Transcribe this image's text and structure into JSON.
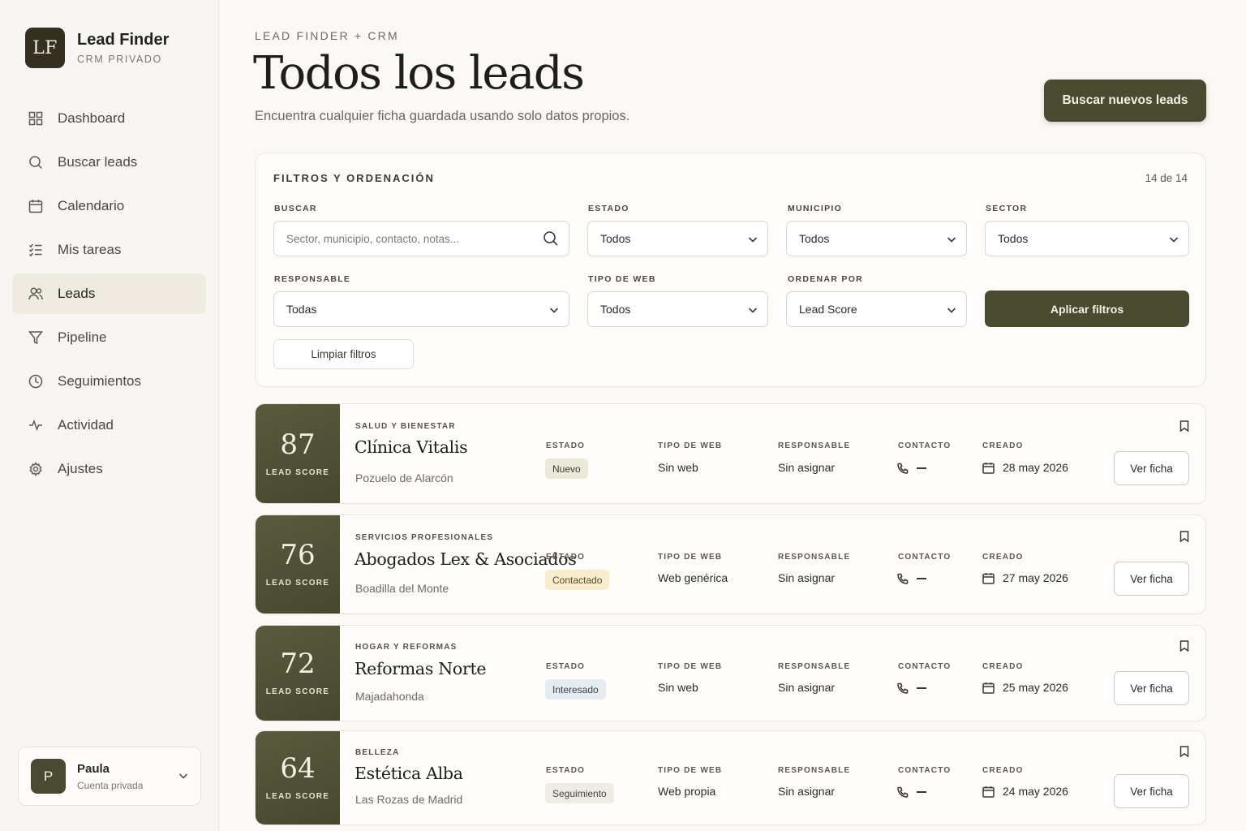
{
  "brand": {
    "logo": "LF",
    "title": "Lead Finder",
    "subtitle": "CRM PRIVADO"
  },
  "nav": [
    {
      "label": "Dashboard",
      "icon": "dashboard-icon"
    },
    {
      "label": "Buscar leads",
      "icon": "search-icon"
    },
    {
      "label": "Calendario",
      "icon": "calendar-icon"
    },
    {
      "label": "Mis tareas",
      "icon": "tasks-icon"
    },
    {
      "label": "Leads",
      "icon": "users-icon",
      "active": true
    },
    {
      "label": "Pipeline",
      "icon": "funnel-icon"
    },
    {
      "label": "Seguimientos",
      "icon": "clock-icon"
    },
    {
      "label": "Actividad",
      "icon": "activity-icon"
    },
    {
      "label": "Ajustes",
      "icon": "gear-icon"
    }
  ],
  "user": {
    "initial": "P",
    "name": "Paula",
    "role": "Cuenta privada"
  },
  "header": {
    "eyebrow": "LEAD FINDER + CRM",
    "title": "Todos los leads",
    "subtitle": "Encuentra cualquier ficha guardada usando solo datos propios.",
    "cta": "Buscar nuevos leads"
  },
  "filters": {
    "title": "FILTROS Y ORDENACIÓN",
    "count": "14 de 14",
    "buscar_label": "BUSCAR",
    "buscar_placeholder": "Sector, municipio, contacto, notas...",
    "estado_label": "ESTADO",
    "estado_value": "Todos",
    "municipio_label": "MUNICIPIO",
    "municipio_value": "Todos",
    "sector_label": "SECTOR",
    "sector_value": "Todos",
    "responsable_label": "RESPONSABLE",
    "responsable_value": "Todas",
    "tipoweb_label": "TIPO DE WEB",
    "tipoweb_value": "Todos",
    "ordenar_label": "ORDENAR POR",
    "ordenar_value": "Lead Score",
    "apply": "Aplicar filtros",
    "clear": "Limpiar filtros"
  },
  "columns": {
    "score": "LEAD SCORE",
    "estado": "ESTADO",
    "tipoweb": "TIPO DE WEB",
    "responsable": "RESPONSABLE",
    "contacto": "CONTACTO",
    "creado": "CREADO",
    "action": "Ver ficha"
  },
  "leads": [
    {
      "score": "87",
      "sector": "SALUD Y BIENESTAR",
      "name": "Clínica Vitalis",
      "town": "Pozuelo de Alarcón",
      "estado": "Nuevo",
      "tipoweb": "Sin web",
      "responsable": "Sin asignar",
      "creado": "28 may 2026"
    },
    {
      "score": "76",
      "sector": "SERVICIOS PROFESIONALES",
      "name": "Abogados Lex & Asociados",
      "town": "Boadilla del Monte",
      "estado": "Contactado",
      "tipoweb": "Web genérica",
      "responsable": "Sin asignar",
      "creado": "27 may 2026"
    },
    {
      "score": "72",
      "sector": "HOGAR Y REFORMAS",
      "name": "Reformas Norte",
      "town": "Majadahonda",
      "estado": "Interesado",
      "tipoweb": "Sin web",
      "responsable": "Sin asignar",
      "creado": "25 may 2026"
    },
    {
      "score": "64",
      "sector": "BELLEZA",
      "name": "Estética Alba",
      "town": "Las Rozas de Madrid",
      "estado": "Seguimiento",
      "tipoweb": "Web propia",
      "responsable": "Sin asignar",
      "creado": "24 may 2026"
    }
  ]
}
